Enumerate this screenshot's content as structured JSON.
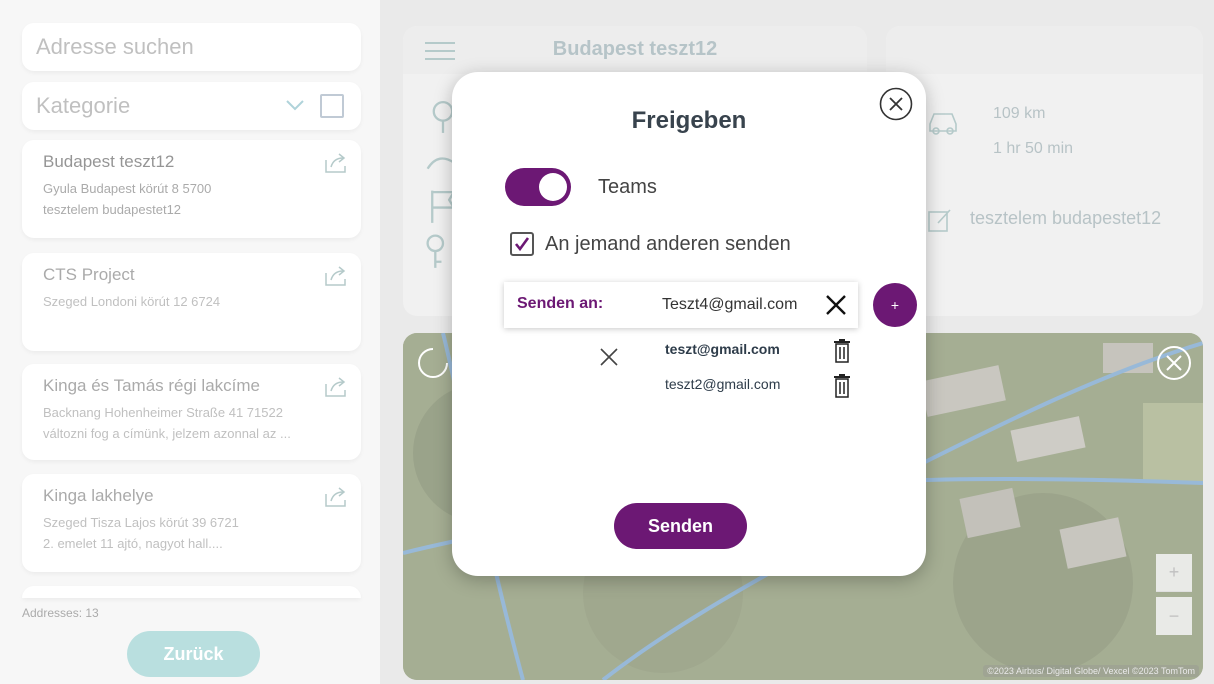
{
  "sidebar": {
    "search_placeholder": "Adresse suchen",
    "category_label": "Kategorie",
    "cards": [
      {
        "title": "Budapest teszt12",
        "line1": "Gyula Budapest körút 8 5700",
        "line2": "tesztelem budapestet12"
      },
      {
        "title": "CTS Project",
        "line1": "Szeged Londoni körút 12 6724",
        "line2": ""
      },
      {
        "title": "Kinga és Tamás régi lakcíme",
        "line1": "Backnang Hohenheimer Straße 41 71522",
        "line2": "változni fog a címünk, jelzem azonnal az ..."
      },
      {
        "title": "Kinga lakhelye",
        "line1": "Szeged Tisza Lajos körút 39 6721",
        "line2": "2. emelet 11 ajtó, nagyot hall...."
      }
    ],
    "address_count": "Addresses: 13",
    "back_label": "Zurück"
  },
  "details": {
    "title": "Budapest teszt12",
    "distance": "109 km",
    "duration": "1 hr 50 min",
    "note": "tesztelem budapestet12"
  },
  "map": {
    "zoom_in": "+",
    "zoom_out": "−",
    "copyright": "©2023 Airbus/ Digital Globe/ Vexcel ©2023 TomTom"
  },
  "modal": {
    "title": "Freigeben",
    "teams_label": "Teams",
    "teams_on": true,
    "checkbox_label": "An jemand anderen senden",
    "checkbox_checked": true,
    "send_to_label": "Senden an:",
    "email_value": "Teszt4@gmail.com",
    "add_label": "+",
    "recipients": [
      "teszt@gmail.com",
      "teszt2@gmail.com"
    ],
    "send_label": "Senden"
  },
  "colors": {
    "accent": "#6c1874",
    "back_button": "#8fcccc"
  }
}
